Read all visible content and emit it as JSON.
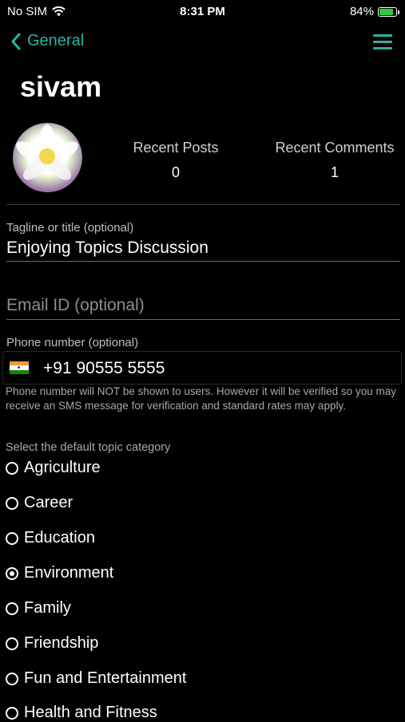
{
  "status_bar": {
    "carrier": "No SIM",
    "time": "8:31 PM",
    "battery": "84%",
    "battery_level": 0.84
  },
  "nav": {
    "back_label": "General"
  },
  "profile": {
    "username": "sivam",
    "recent_posts_label": "Recent Posts",
    "recent_posts_count": "0",
    "recent_comments_label": "Recent Comments",
    "recent_comments_count": "1"
  },
  "form": {
    "tagline_label": "Tagline or title (optional)",
    "tagline_value": "Enjoying Topics Discussion",
    "email_placeholder": "Email ID (optional)",
    "phone_label": "Phone number (optional)",
    "phone_value": "+91 90555 5555",
    "phone_note": "Phone number will NOT be shown to users. However it will be verified so you may receive an SMS message for verification and standard rates may apply.",
    "category_label": "Select the default topic category",
    "categories": [
      {
        "label": "Agriculture",
        "selected": false
      },
      {
        "label": "Career",
        "selected": false
      },
      {
        "label": "Education",
        "selected": false
      },
      {
        "label": "Environment",
        "selected": true
      },
      {
        "label": "Family",
        "selected": false
      },
      {
        "label": "Friendship",
        "selected": false
      },
      {
        "label": "Fun and Entertainment",
        "selected": false
      },
      {
        "label": "Health and Fitness",
        "selected": false
      }
    ]
  },
  "colors": {
    "accent": "#2bb3a2",
    "background": "#000000"
  }
}
